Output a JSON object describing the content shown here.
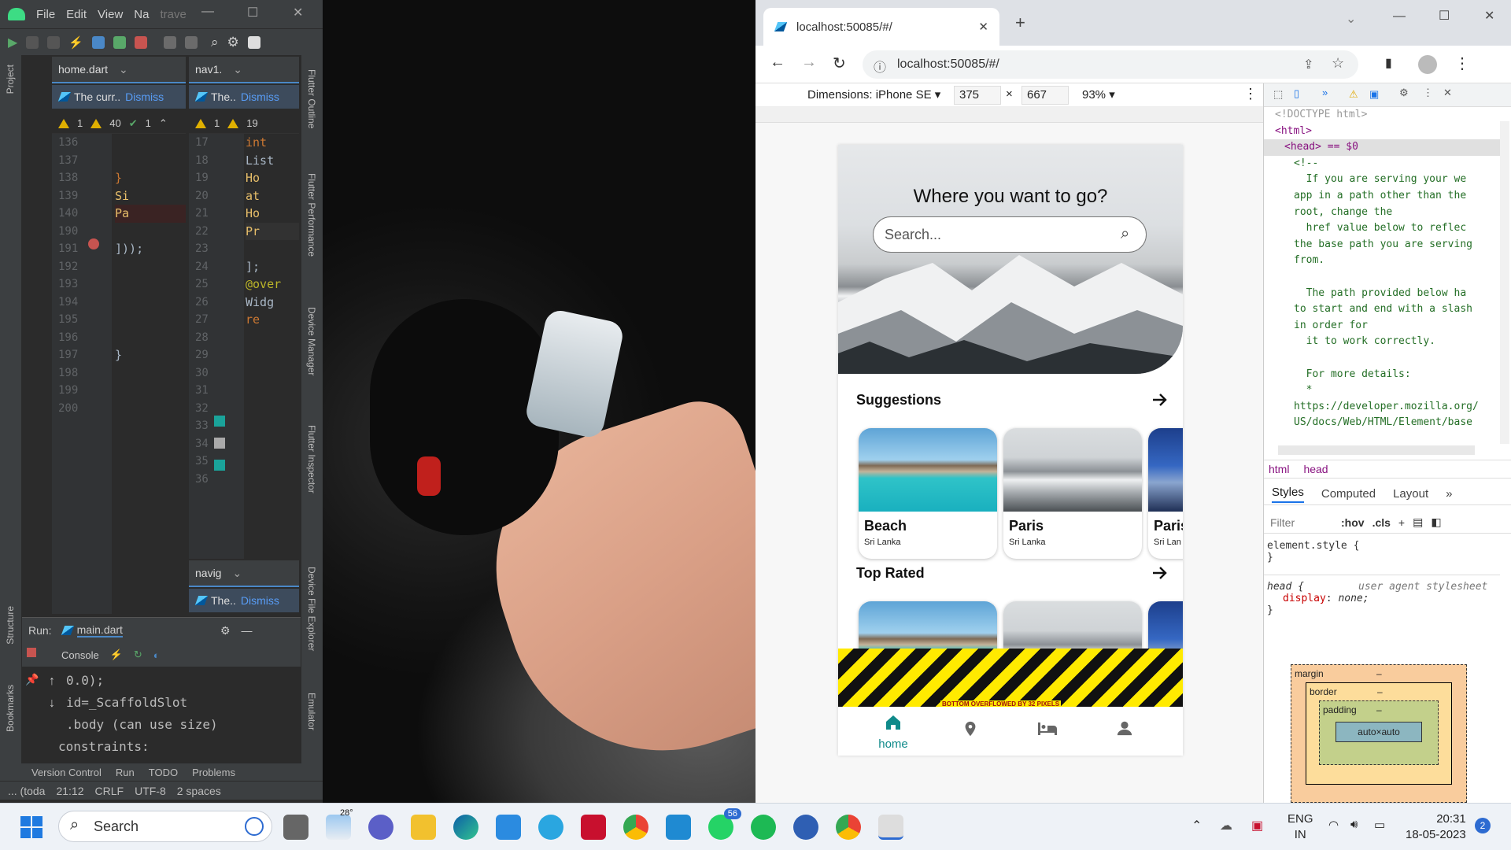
{
  "studio": {
    "menu": [
      "File",
      "Edit",
      "View",
      "Na",
      "trave"
    ],
    "tabs": {
      "left": "home.dart",
      "right": "nav1.",
      "bottom": "navig"
    },
    "notice": {
      "left": "The curr..",
      "right": "The..",
      "bottom": "The..",
      "dismiss": "Dismiss"
    },
    "warnings": {
      "left_a": "1",
      "left_b": "40",
      "left_c": "1",
      "right_a": "1",
      "right_b": "19"
    },
    "left_lines": [
      "136",
      "137",
      "138",
      "139",
      "140",
      "190",
      "191",
      "192",
      "193",
      "194",
      "195",
      "196",
      "197",
      "198",
      "199",
      "200"
    ],
    "left_code": [
      "",
      "",
      "}",
      "Si",
      "Pa",
      "",
      "]));",
      "",
      "",
      "",
      "",
      "",
      "}",
      "",
      "",
      ""
    ],
    "right_lines": [
      "17",
      "18",
      "19",
      "20",
      "21",
      "22",
      "23",
      "24",
      "25",
      "26",
      "27",
      "28",
      "29",
      "30",
      "31",
      "32",
      "33",
      "34",
      "35",
      "36"
    ],
    "right_code": [
      "int",
      "List",
      "Ho",
      "at",
      "Ho",
      "Pr",
      "",
      "];",
      "@over",
      "Widg",
      "re",
      "",
      "",
      "",
      "",
      "",
      "",
      "",
      "",
      ""
    ],
    "left_strip": [
      "Project",
      "Structure",
      "Bookmarks"
    ],
    "right_strip": [
      "Flutter Outline",
      "Flutter Performance",
      "Device Manager",
      "Flutter Inspector",
      "Device File Explorer",
      "Emulator"
    ],
    "run": {
      "label": "Run:",
      "file": "main.dart",
      "console_tab": "Console",
      "lines": [
        "0.0);",
        "id=_ScaffoldSlot",
        ".body (can use size)",
        "constraints:"
      ]
    },
    "bottom_tabs": [
      "Version Control",
      "Run",
      "TODO",
      "Problems"
    ],
    "status": [
      "... (toda",
      "21:12",
      "CRLF",
      "UTF-8",
      "2 spaces"
    ]
  },
  "chrome": {
    "tab_title": "localhost:50085/#/",
    "url": "localhost:50085/#/",
    "device": {
      "label": "Dimensions: iPhone SE ▾",
      "width": "375",
      "times": "×",
      "height": "667",
      "zoom": "93% ▾"
    }
  },
  "app": {
    "hero_title": "Where you want to go?",
    "search_placeholder": "Search...",
    "sections": {
      "suggestions": "Suggestions",
      "top_rated": "Top Rated"
    },
    "suggestion_cards": [
      {
        "name": "Beach",
        "location": "Sri Lanka"
      },
      {
        "name": "Paris",
        "location": "Sri Lanka"
      },
      {
        "name": "Paris",
        "location": "Sri Lan"
      }
    ],
    "overflow_message": "BOTTOM OVERFLOWED BY 32 PIXELS",
    "nav": {
      "home": "home"
    }
  },
  "devtools": {
    "source": [
      "<!DOCTYPE html>",
      "<html>",
      "<head> == $0",
      "<!--",
      "  If you are serving your we",
      "app in a path other than the",
      "root, change the",
      "  href value below to reflec",
      "the base path you are serving",
      "from.",
      "",
      "  The path provided below ha",
      "to start and end with a slash",
      "in order for",
      "  it to work correctly.",
      "",
      "  For more details:",
      "  *",
      "https://developer.mozilla.org/",
      "US/docs/Web/HTML/Element/base"
    ],
    "crumbs": [
      "html",
      "head"
    ],
    "tabs": [
      "Styles",
      "Computed",
      "Layout"
    ],
    "filter": "Filter",
    "hov": ":hov",
    "cls": ".cls",
    "rule1": "element.style {",
    "rule1_close": "}",
    "rule2_sel": "head {",
    "rule2_src": "user agent stylesheet",
    "rule2_prop": "display",
    "rule2_val": "none;",
    "rule2_close": "}",
    "box": {
      "margin": "margin",
      "border": "border",
      "padding": "padding",
      "content": "auto×auto",
      "dash": "–"
    }
  },
  "taskbar": {
    "search": "Search",
    "weather": "28°",
    "whatsapp_badge": "56",
    "lang": "ENG",
    "region": "IN",
    "time": "20:31",
    "date": "18-05-2023",
    "notif": "2"
  }
}
